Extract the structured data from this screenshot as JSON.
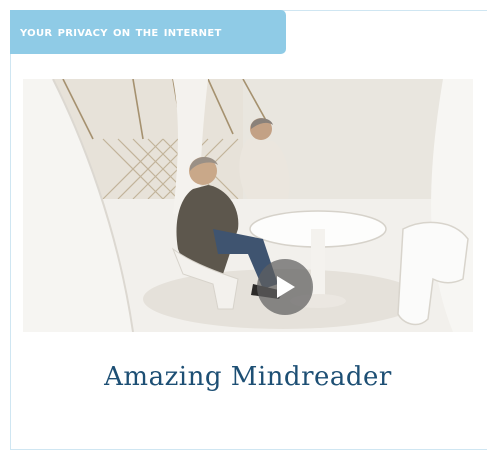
{
  "section_tab": {
    "label": "Your privacy on the internet"
  },
  "video": {
    "play_icon": "play-icon"
  },
  "article": {
    "title": "Amazing Mindreader"
  },
  "colors": {
    "tab_bg": "#8fcbe6",
    "title": "#1d4f74",
    "border": "#cfe6f2"
  }
}
